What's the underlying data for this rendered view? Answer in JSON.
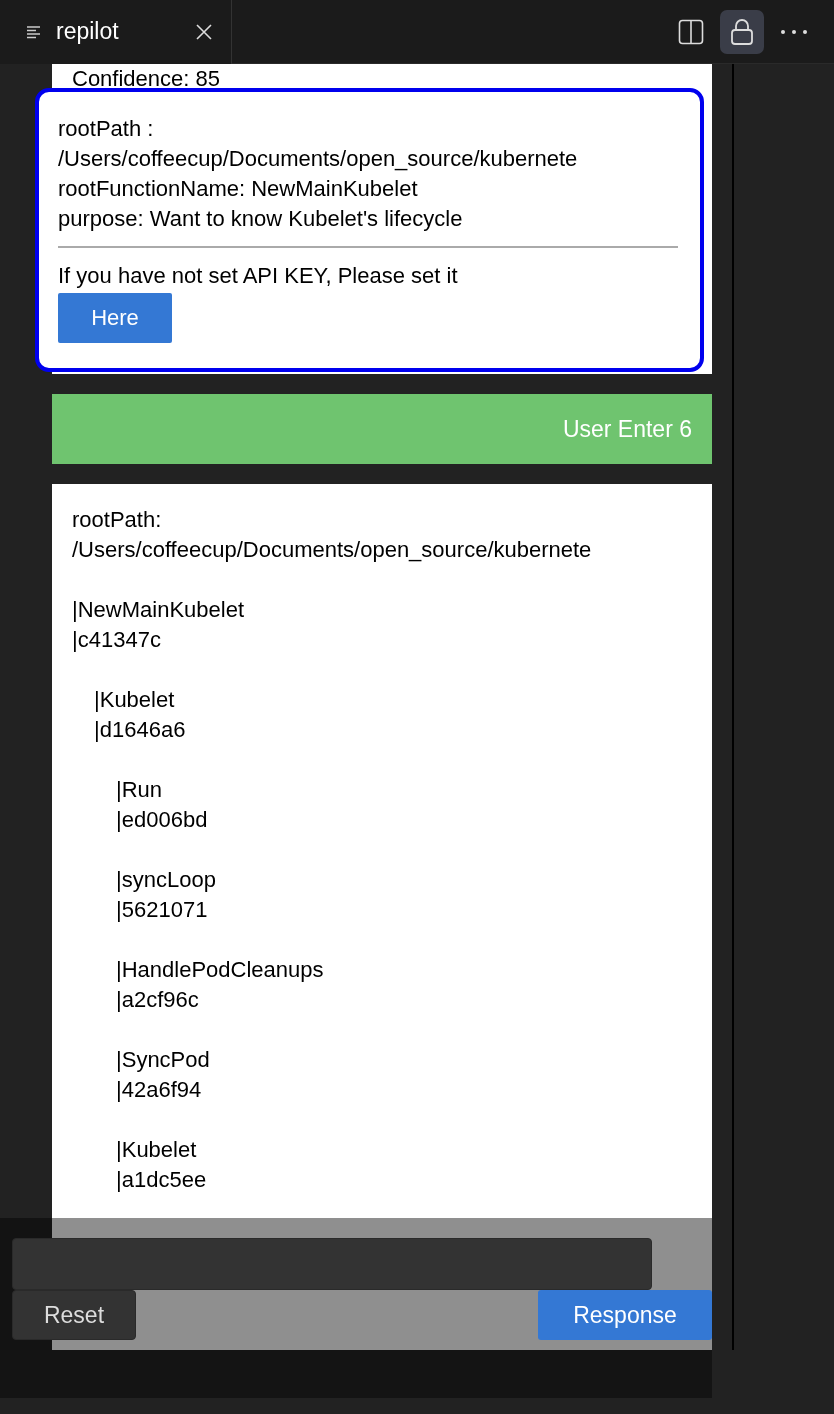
{
  "tab": {
    "title": "repilot"
  },
  "toolbar": {
    "lock_selected": true
  },
  "history_card": {
    "text": "Confidence: 85"
  },
  "popup": {
    "lines": [
      "rootPath :",
      "/Users/coffeecup/Documents/open_source/kubernete",
      "rootFunctionName: NewMainKubelet",
      "purpose: Want to know Kubelet's lifecycle"
    ],
    "notice": "If you have not set API KEY, Please set it",
    "button": "Here"
  },
  "user_message": "User Enter 6",
  "response_card": {
    "label": "rootPath:",
    "path": "/Users/coffeecup/Documents/open_source/kubernete",
    "tree": [
      {
        "name": "|NewMainKubelet",
        "hash": "|c41347c",
        "children": [
          {
            "name": "|Kubelet",
            "hash": "|d1646a6",
            "children": [
              {
                "name": "|Run",
                "hash": "|ed006bd"
              },
              {
                "name": "|syncLoop",
                "hash": "|5621071"
              },
              {
                "name": "|HandlePodCleanups",
                "hash": "|a2cf96c"
              },
              {
                "name": "|SyncPod",
                "hash": "|42a6f94"
              },
              {
                "name": "|Kubelet",
                "hash": "|a1dc5ee"
              }
            ]
          }
        ]
      }
    ]
  },
  "reset_button": "Reset",
  "response_button": "Response"
}
